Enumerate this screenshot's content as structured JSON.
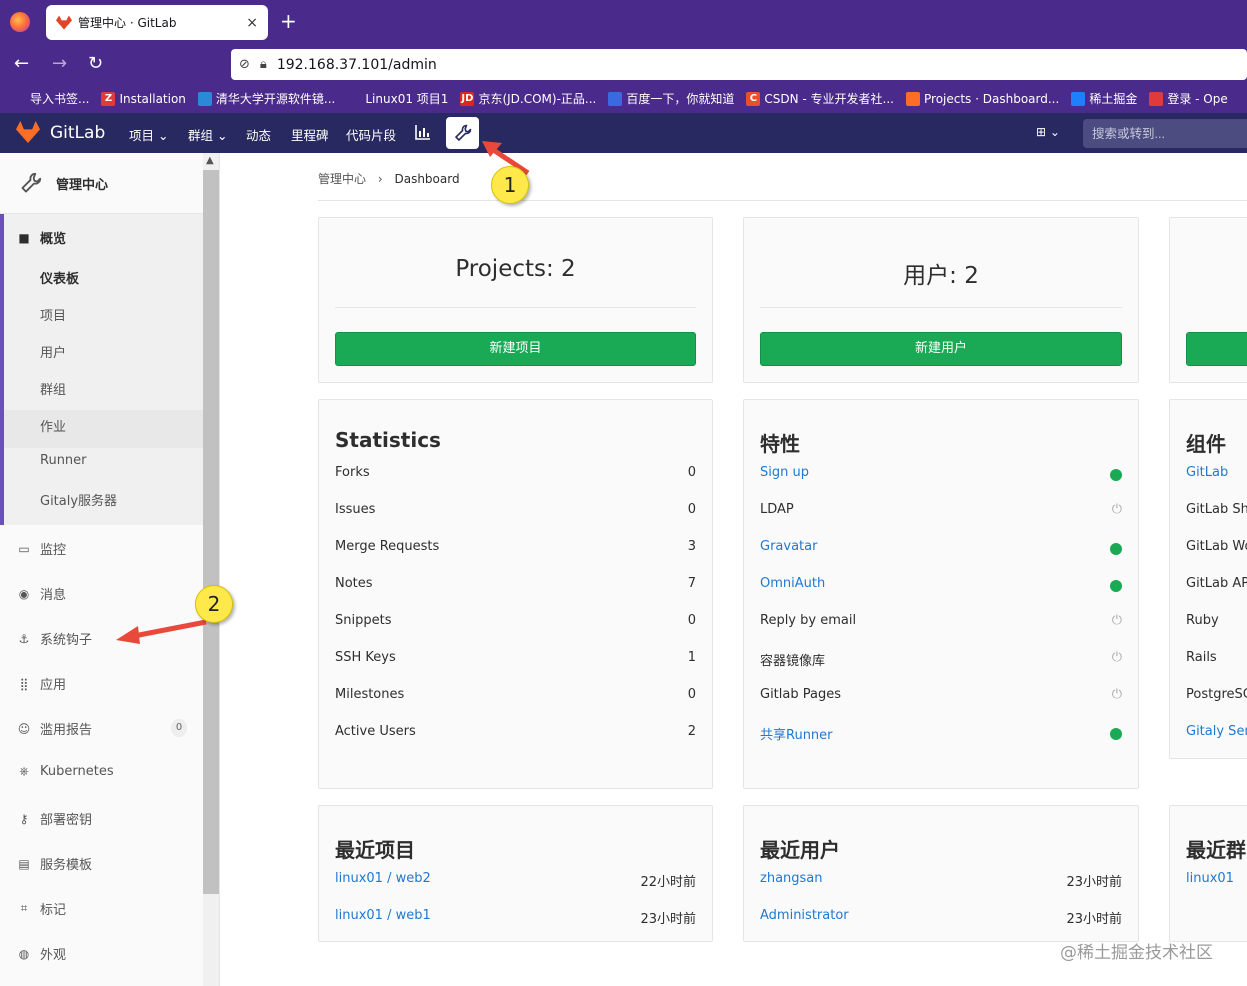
{
  "browser": {
    "tab_title": "管理中心 · GitLab",
    "tab_close": "×",
    "new_tab": "+",
    "url": "192.168.37.101/admin",
    "bookmarks": [
      {
        "label": "导入书签...",
        "icon": "import-icon",
        "color": "#4a2a8a"
      },
      {
        "label": "Installation",
        "icon": "Z",
        "color": "#e03a3a"
      },
      {
        "label": "清华大学开源软件镜...",
        "icon": "mirror-icon",
        "color": "#2a8ad8"
      },
      {
        "label": "Linux01 项目1",
        "icon": "globe-icon",
        "color": "#4a2a8a"
      },
      {
        "label": "京东(JD.COM)-正品...",
        "icon": "JD",
        "color": "#e1251b"
      },
      {
        "label": "百度一下，你就知道",
        "icon": "baidu-icon",
        "color": "#3a6ae0"
      },
      {
        "label": "CSDN - 专业开发者社...",
        "icon": "C",
        "color": "#e8502a"
      },
      {
        "label": "Projects · Dashboard...",
        "icon": "gitlab-icon",
        "color": "#fc6d26"
      },
      {
        "label": "稀土掘金",
        "icon": "juejin-icon",
        "color": "#1e80ff"
      },
      {
        "label": "登录 - Ope",
        "icon": "login-icon",
        "color": "#e03a3a"
      }
    ]
  },
  "header": {
    "brand": "GitLab",
    "nav": [
      "项目 ⌄",
      "群组 ⌄",
      "动态",
      "里程碑",
      "代码片段"
    ],
    "plus": "⊞ ⌄",
    "search_placeholder": "搜索或转到..."
  },
  "sidebar": {
    "title": "管理中心",
    "overview": "概览",
    "overview_items": [
      "仪表板",
      "项目",
      "用户",
      "群组",
      "作业",
      "Runner",
      "Gitaly服务器"
    ],
    "sections": [
      {
        "label": "监控",
        "icon": "monitor-icon"
      },
      {
        "label": "消息",
        "icon": "broadcast-icon"
      },
      {
        "label": "系统钩子",
        "icon": "hook-icon"
      },
      {
        "label": "应用",
        "icon": "apps-icon"
      },
      {
        "label": "滥用报告",
        "icon": "abuse-icon",
        "badge": "0"
      },
      {
        "label": "Kubernetes",
        "icon": "kubernetes-icon"
      },
      {
        "label": "部署密钥",
        "icon": "key-icon"
      },
      {
        "label": "服务模板",
        "icon": "template-icon"
      },
      {
        "label": "标记",
        "icon": "label-icon"
      },
      {
        "label": "外观",
        "icon": "appearance-icon"
      }
    ]
  },
  "breadcrumb": {
    "root": "管理中心",
    "sep": "›",
    "current": "Dashboard"
  },
  "counts": {
    "projects": {
      "title": "Projects: 2",
      "button": "新建项目"
    },
    "users": {
      "title": "用户: 2",
      "button": "新建用户"
    }
  },
  "statistics": {
    "title": "Statistics",
    "rows": [
      {
        "label": "Forks",
        "value": "0"
      },
      {
        "label": "Issues",
        "value": "0"
      },
      {
        "label": "Merge Requests",
        "value": "3"
      },
      {
        "label": "Notes",
        "value": "7"
      },
      {
        "label": "Snippets",
        "value": "0"
      },
      {
        "label": "SSH Keys",
        "value": "1"
      },
      {
        "label": "Milestones",
        "value": "0"
      },
      {
        "label": "Active Users",
        "value": "2"
      }
    ]
  },
  "features": {
    "title": "特性",
    "rows": [
      {
        "label": "Sign up",
        "link": true,
        "on": true
      },
      {
        "label": "LDAP",
        "link": false,
        "on": false
      },
      {
        "label": "Gravatar",
        "link": true,
        "on": true
      },
      {
        "label": "OmniAuth",
        "link": true,
        "on": true
      },
      {
        "label": "Reply by email",
        "link": false,
        "on": false
      },
      {
        "label": "容器镜像库",
        "link": false,
        "on": false
      },
      {
        "label": "Gitlab Pages",
        "link": false,
        "on": false
      },
      {
        "label": "共享Runner",
        "link": true,
        "on": true
      }
    ]
  },
  "components": {
    "title": "组件",
    "rows": [
      {
        "label": "GitLab",
        "link": true
      },
      {
        "label": "GitLab She",
        "link": false
      },
      {
        "label": "GitLab Wo",
        "link": false
      },
      {
        "label": "GitLab AP",
        "link": false
      },
      {
        "label": "Ruby",
        "link": false
      },
      {
        "label": "Rails",
        "link": false
      },
      {
        "label": "PostgreSC",
        "link": false
      },
      {
        "label": "Gitaly Serv",
        "link": true
      }
    ]
  },
  "recent_projects": {
    "title": "最近项目",
    "rows": [
      {
        "label": "linux01 / web2",
        "time": "22小时前"
      },
      {
        "label": "linux01 / web1",
        "time": "23小时前"
      }
    ]
  },
  "recent_users": {
    "title": "最近用户",
    "rows": [
      {
        "label": "zhangsan",
        "time": "23小时前"
      },
      {
        "label": "Administrator",
        "time": "23小时前"
      }
    ]
  },
  "recent_groups": {
    "title": "最近群",
    "rows": [
      {
        "label": "linux01"
      }
    ]
  },
  "annotations": {
    "one": "1",
    "two": "2"
  },
  "watermark": "@稀土掘金技术社区",
  "colors": {
    "header": "#292961",
    "browser": "#4a2a8a",
    "green": "#1aaa55",
    "link": "#1f78d1",
    "accent": "#6b4fbb"
  }
}
